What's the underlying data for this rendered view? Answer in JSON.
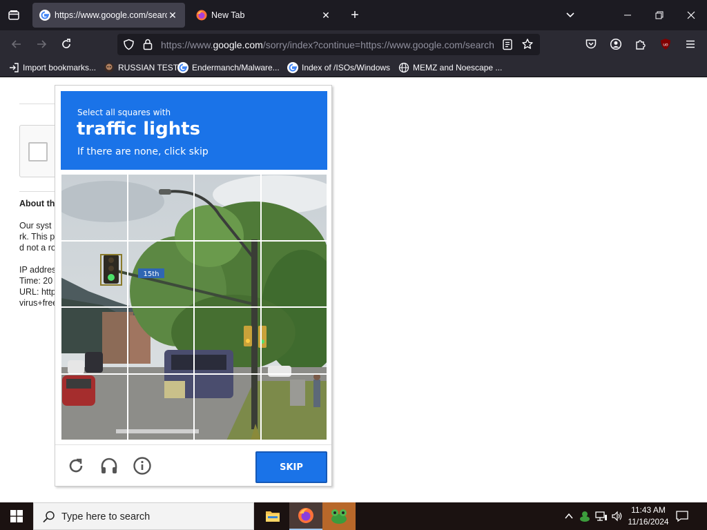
{
  "browser": {
    "tabs": [
      {
        "title": "https://www.google.com/search",
        "active": true,
        "icon": "google-icon"
      },
      {
        "title": "New Tab",
        "active": false,
        "icon": "firefox-icon"
      }
    ],
    "url_prefix": "https://www.",
    "url_domain": "google.com",
    "url_rest": "/sorry/index?continue=https://www.google.com/search",
    "bookmarks": [
      {
        "label": "Import bookmarks...",
        "icon": "import-icon"
      },
      {
        "label": "RUSSIAN TEST",
        "icon": "skull-icon"
      },
      {
        "label": "Endermanch/Malware...",
        "icon": "google-icon"
      },
      {
        "label": "Index of /ISOs/Windows",
        "icon": "google-icon"
      },
      {
        "label": "MEMZ and Noescape ...",
        "icon": "globe-icon"
      }
    ]
  },
  "page": {
    "about_title": "About th",
    "lines": [
      "Our syst",
      "rk. This p",
      "d not a ro",
      "IP addres",
      "Time: 20",
      "URL: http",
      "virus+free"
    ]
  },
  "captcha": {
    "instruction_small": "Select all squares with",
    "target": "traffic lights",
    "instruction_sub": "If there are none, click skip",
    "skip_label": "SKIP",
    "street_sign": "15th",
    "colors": {
      "header": "#1a73e8",
      "button": "#1a73e8"
    }
  },
  "taskbar": {
    "search_placeholder": "Type here to search",
    "time": "11:43 AM",
    "date": "11/16/2024"
  }
}
